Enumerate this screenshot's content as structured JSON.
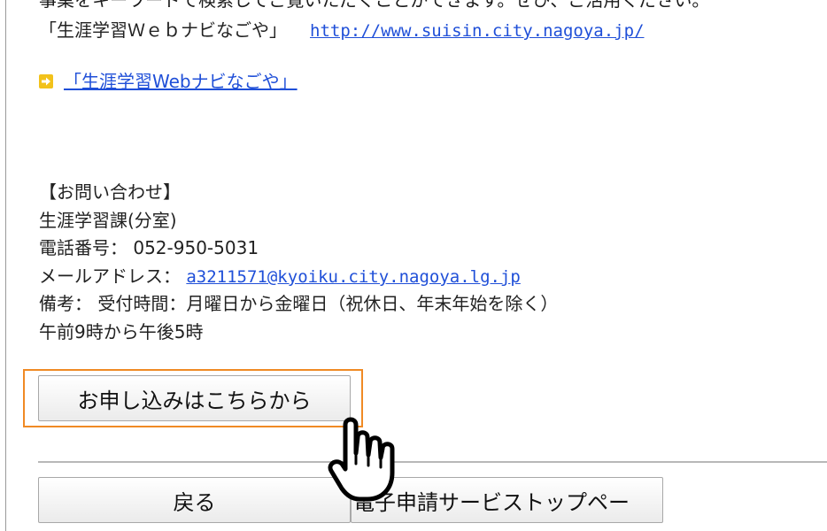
{
  "intro": {
    "line1": "事業をキーワードで検索してご覧いただくことができます。ぜひ、ご活用ください。",
    "site_name": "「生涯学習Ｗｅｂナビなごや」",
    "site_url": "http://www.suisin.city.nagoya.jp/"
  },
  "navi_link": {
    "label": "「生涯学習Webナビなごや」"
  },
  "contact": {
    "heading": "【お問い合わせ】",
    "department": "生涯学習課(分室)",
    "phone_label": "電話番号：",
    "phone": "052-950-5031",
    "email_label": "メールアドレス：",
    "email": "a3211571@kyoiku.city.nagoya.lg.jp",
    "note_label": "備考：",
    "note_line1": "受付時間：月曜日から金曜日（祝休日、年末年始を除く）",
    "note_line2": "午前9時から午後5時"
  },
  "buttons": {
    "apply": "お申し込みはこちらから",
    "back": "戻る",
    "service_top": "電子申請サービストップペー"
  },
  "colors": {
    "link": "#1f4fd8",
    "highlight": "#f08a24",
    "arrow_icon": "#f2c21b"
  },
  "icons": {
    "arrow": "arrow-right-icon",
    "cursor": "hand-pointer-icon"
  }
}
